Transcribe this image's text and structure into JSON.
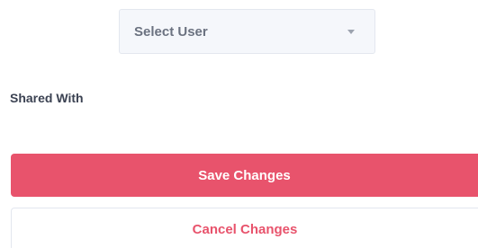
{
  "user_select": {
    "selected_label": "Select User",
    "caret_icon": "chevron-down-icon"
  },
  "shared_with": {
    "label": "Shared With"
  },
  "actions": {
    "save_label": "Save Changes",
    "cancel_label": "Cancel Changes"
  },
  "colors": {
    "accent": "#e8536c",
    "select_bg": "#f5f7fb",
    "text_dark": "#3b4252",
    "text_muted": "#6b7280"
  }
}
